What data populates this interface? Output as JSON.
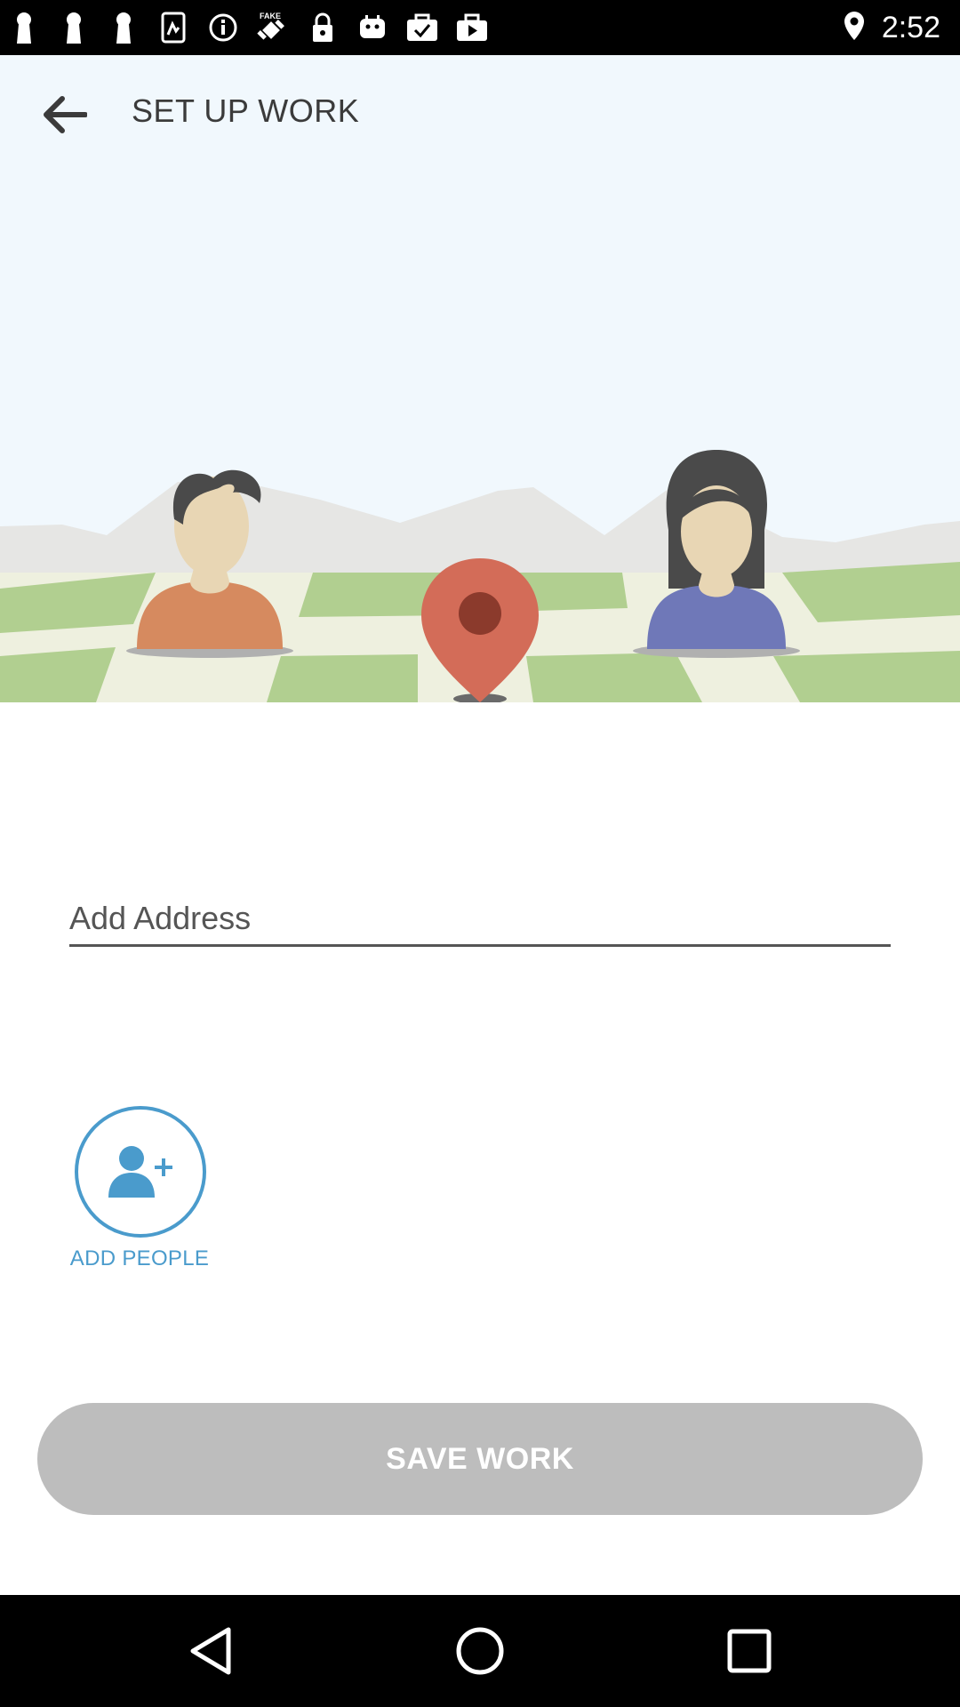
{
  "status_bar": {
    "time": "2:52",
    "left_icons": [
      "keyhole-icon",
      "keyhole-icon",
      "keyhole-icon",
      "file-icon",
      "info-icon",
      "fake-gps-icon",
      "lock-icon",
      "android-icon",
      "check-list-icon",
      "briefcase-icon",
      "play-bag-icon"
    ],
    "right_icons": [
      "location-pin-icon"
    ]
  },
  "header": {
    "title": "SET UP WORK",
    "background": "#f1f8fd"
  },
  "address": {
    "placeholder": "Add Address",
    "value": ""
  },
  "add_people": {
    "label": "ADD PEOPLE",
    "color": "#4a9bcc"
  },
  "save_button": {
    "label": "SAVE WORK",
    "color": "#bdbdbd",
    "enabled": false
  },
  "nav": {
    "back": "back-triangle-icon",
    "home": "home-circle-icon",
    "recents": "recents-square-icon"
  }
}
